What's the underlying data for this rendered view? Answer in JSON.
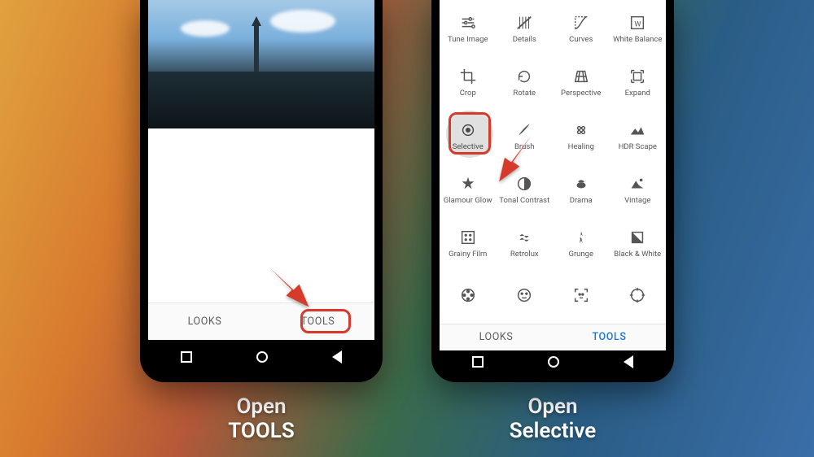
{
  "captions": {
    "left_line1": "Open",
    "left_line2": "TOOLS",
    "right_line1": "Open",
    "right_line2": "Selective"
  },
  "phone1": {
    "tabs": {
      "looks": "LOOKS",
      "tools": "TOOLS"
    }
  },
  "phone2": {
    "tabs": {
      "looks": "LOOKS",
      "tools": "TOOLS"
    },
    "tools": [
      "Tune Image",
      "Details",
      "Curves",
      "White Balance",
      "Crop",
      "Rotate",
      "Perspective",
      "Expand",
      "Selective",
      "Brush",
      "Healing",
      "HDR Scape",
      "Glamour Glow",
      "Tonal Contrast",
      "Drama",
      "Vintage",
      "Grainy Film",
      "Retrolux",
      "Grunge",
      "Black & White",
      "",
      "",
      "",
      ""
    ]
  }
}
